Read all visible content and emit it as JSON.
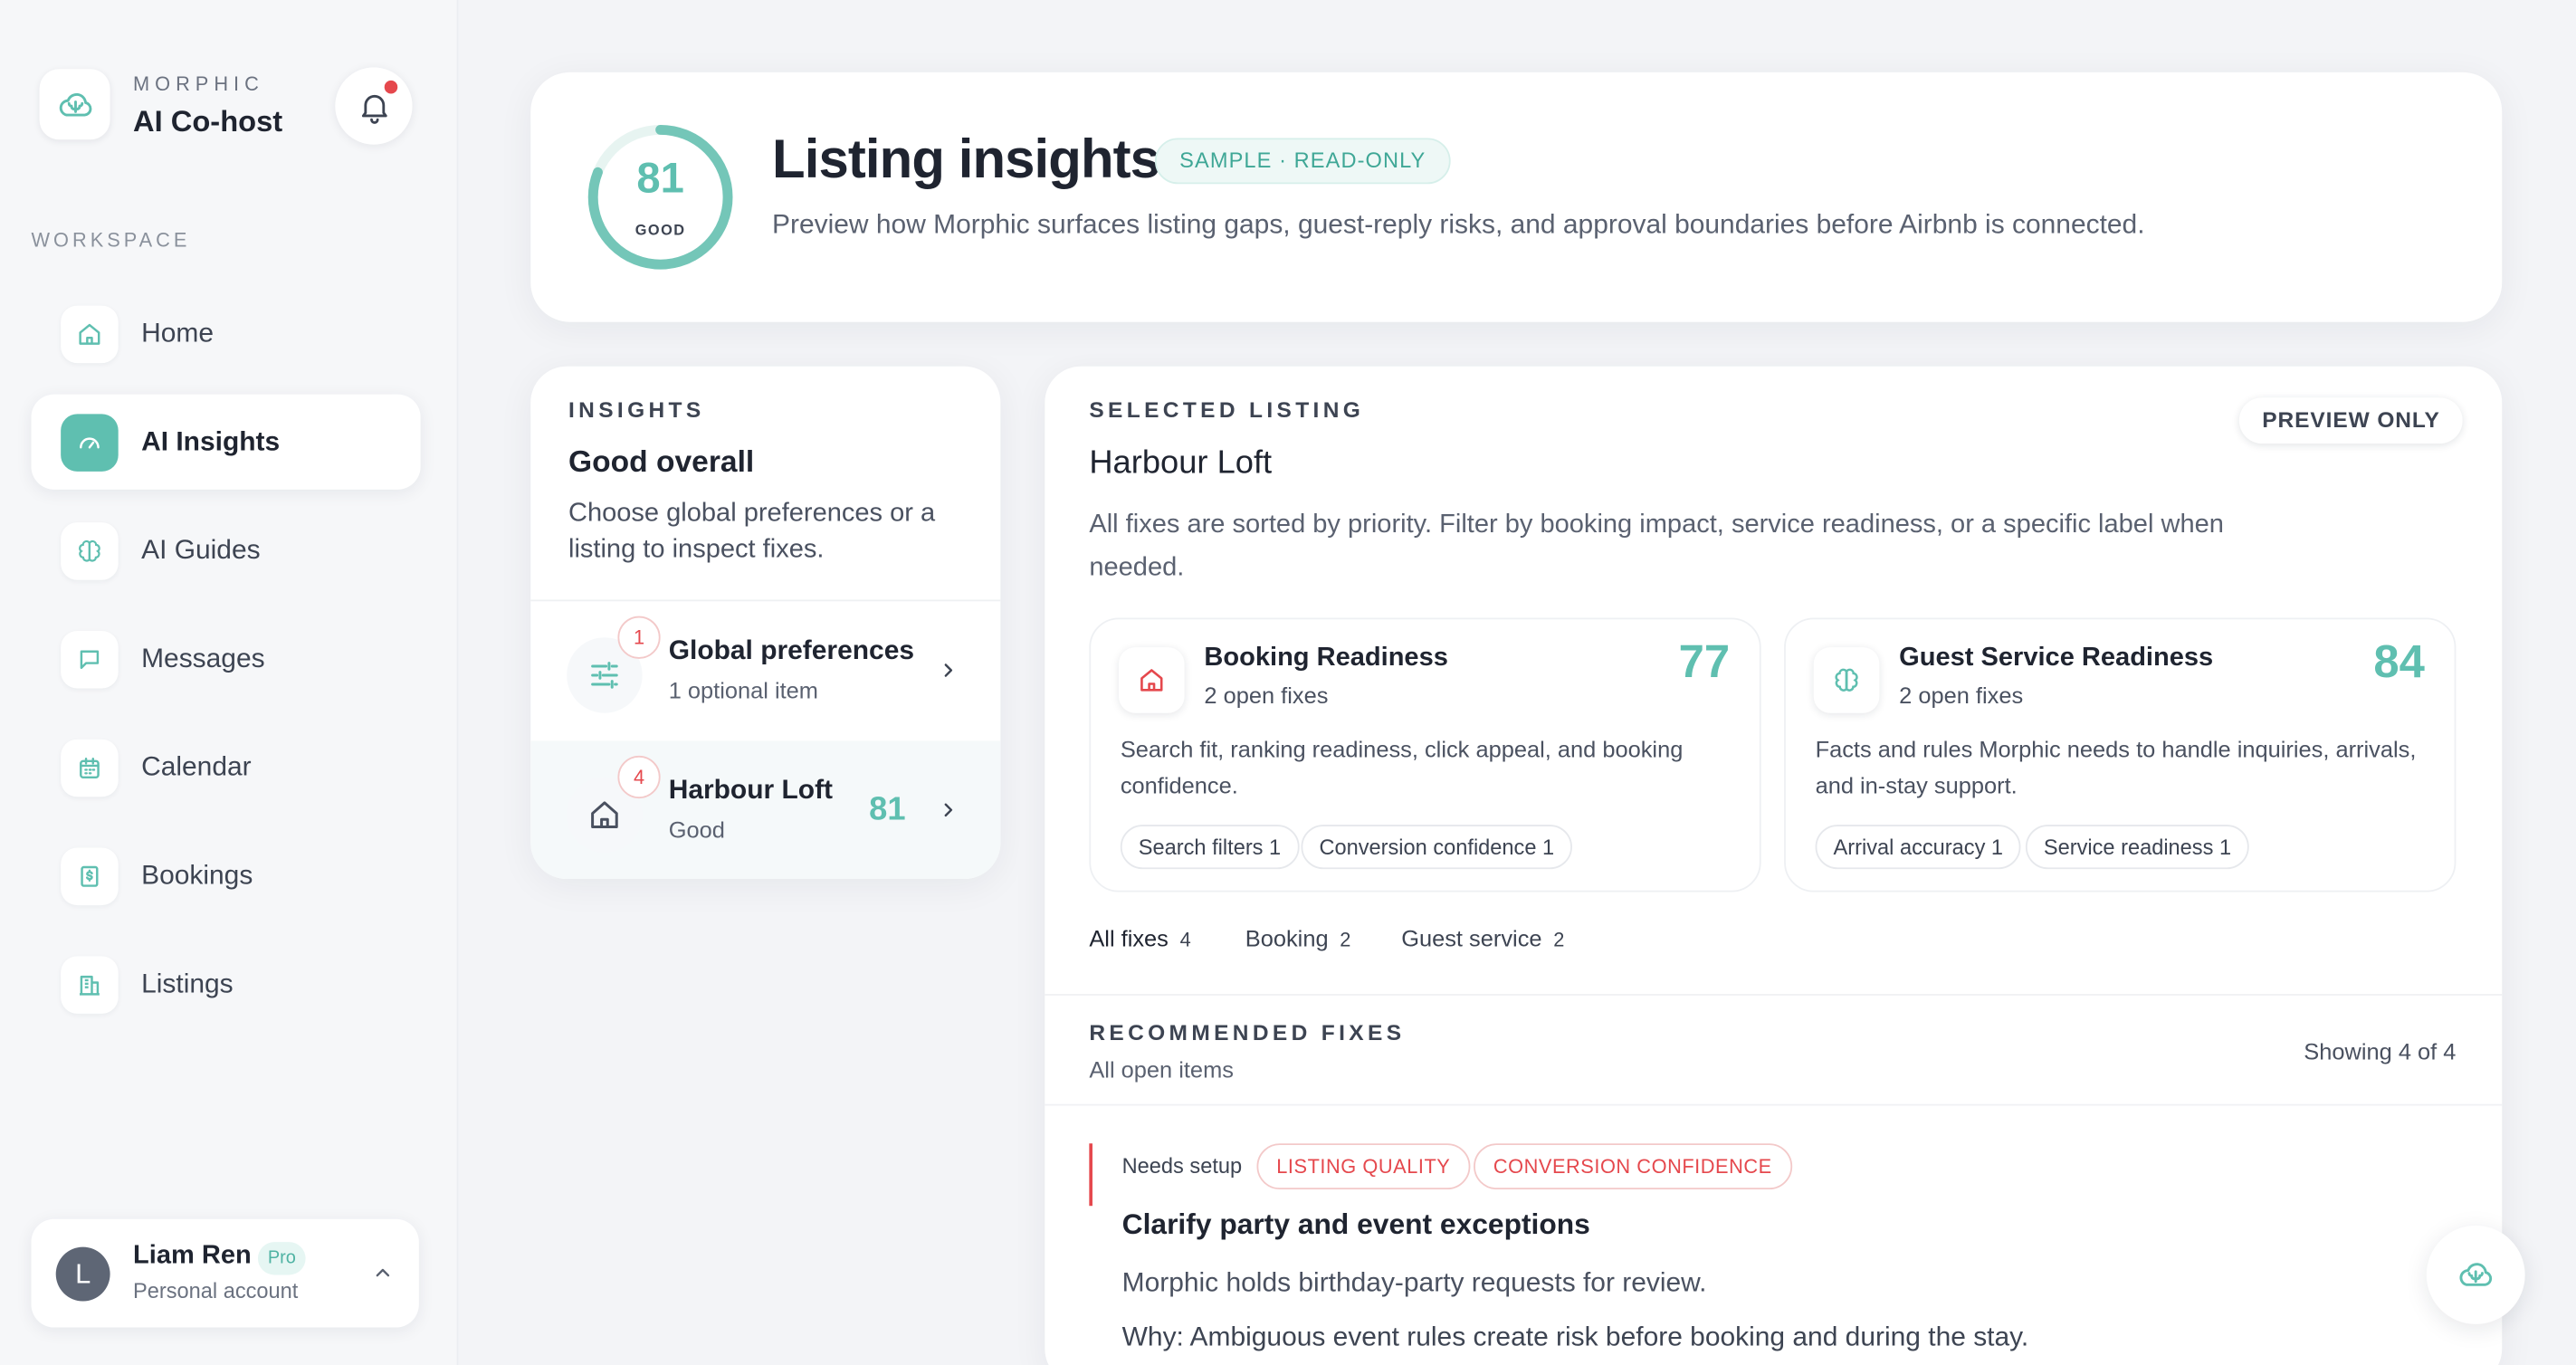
{
  "brand": {
    "small": "MORPHIC",
    "name": "AI Co-host",
    "logo_icon": "cloud-brain-icon"
  },
  "sidebar": {
    "section_label": "WORKSPACE",
    "items": [
      {
        "label": "Home",
        "icon": "home-icon"
      },
      {
        "label": "AI Insights",
        "icon": "gauge-icon",
        "active": true
      },
      {
        "label": "AI Guides",
        "icon": "brain-icon"
      },
      {
        "label": "Messages",
        "icon": "message-icon"
      },
      {
        "label": "Calendar",
        "icon": "calendar-icon"
      },
      {
        "label": "Bookings",
        "icon": "receipt-icon"
      },
      {
        "label": "Listings",
        "icon": "building-icon"
      }
    ]
  },
  "user": {
    "initial": "L",
    "name": "Liam Ren",
    "badge": "Pro",
    "account": "Personal account"
  },
  "hero": {
    "score": "81",
    "score_fraction": 0.81,
    "score_label": "GOOD",
    "title": "Listing insights",
    "badge": "SAMPLE · READ-ONLY",
    "subtitle": "Preview how Morphic surfaces listing gaps, guest-reply risks, and approval boundaries before Airbnb is connected."
  },
  "insights": {
    "kicker": "INSIGHTS",
    "title": "Good overall",
    "description": "Choose global preferences or a listing to inspect fixes.",
    "rows": [
      {
        "badge": "1",
        "title": "Global preferences",
        "subtitle": "1 optional item",
        "icon": "sliders-icon"
      },
      {
        "badge": "4",
        "title": "Harbour Loft",
        "subtitle": "Good",
        "score": "81",
        "icon": "house-icon",
        "selected": true
      }
    ]
  },
  "selected": {
    "kicker": "SELECTED LISTING",
    "title": "Harbour Loft",
    "preview_label": "PREVIEW ONLY",
    "description": "All fixes are sorted by priority. Filter by booking impact, service readiness, or a specific label when needed.",
    "readiness": [
      {
        "title": "Booking Readiness",
        "subtitle": "2 open fixes",
        "score": "77",
        "icon": "home-icon",
        "description": "Search fit, ranking readiness, click appeal, and booking confidence.",
        "tags": [
          "Search filters 1",
          "Conversion confidence 1"
        ]
      },
      {
        "title": "Guest Service Readiness",
        "subtitle": "2 open fixes",
        "score": "84",
        "icon": "brain-icon",
        "description": "Facts and rules Morphic needs to handle inquiries, arrivals, and in-stay support.",
        "tags": [
          "Arrival accuracy 1",
          "Service readiness 1"
        ]
      }
    ],
    "filters": [
      {
        "label": "All fixes",
        "count": "4",
        "active": true
      },
      {
        "label": "Booking",
        "count": "2"
      },
      {
        "label": "Guest service",
        "count": "2"
      }
    ]
  },
  "recommended": {
    "kicker": "RECOMMENDED FIXES",
    "subtitle": "All open items",
    "count_label": "Showing 4 of 4",
    "fix": {
      "status": "Needs setup",
      "tags": [
        "LISTING QUALITY",
        "CONVERSION CONFIDENCE"
      ],
      "title": "Clarify party and event exceptions",
      "line1": "Morphic holds birthday-party requests for review.",
      "line2": "Why: Ambiguous event rules create risk before booking and during the stay."
    }
  },
  "colors": {
    "accent": "#5fbfb0",
    "alert": "#e5484d",
    "text": "#1f2430"
  }
}
